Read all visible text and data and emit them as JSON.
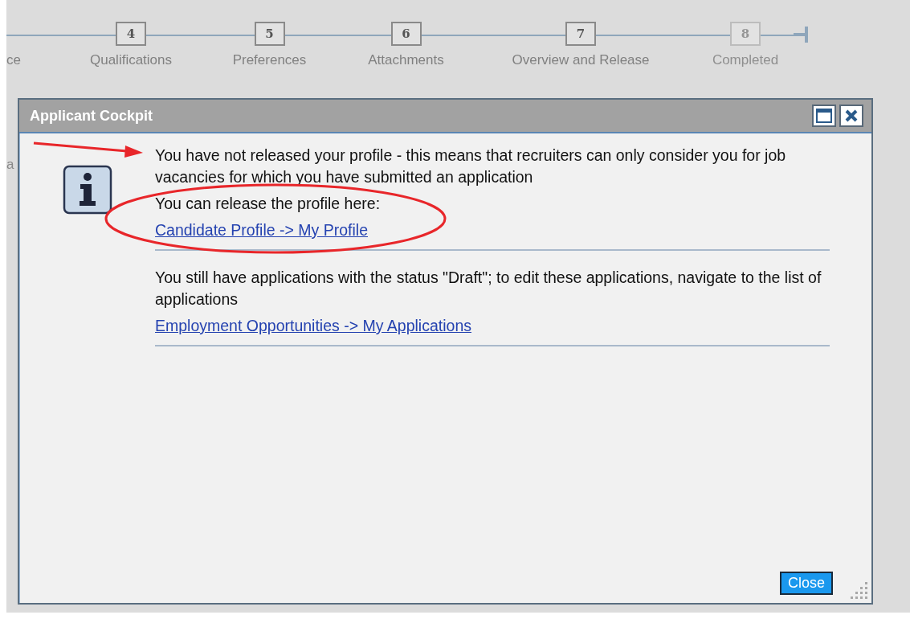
{
  "steps": [
    {
      "label": "ce",
      "disabled": false
    },
    {
      "number": "4",
      "label": "Qualifications",
      "disabled": false
    },
    {
      "number": "5",
      "label": "Preferences",
      "disabled": false
    },
    {
      "number": "6",
      "label": "Attachments",
      "disabled": false
    },
    {
      "number": "7",
      "label": "Overview and Release",
      "disabled": false
    },
    {
      "number": "8",
      "label": "Completed",
      "disabled": true
    }
  ],
  "page_fragment": "a",
  "dialog": {
    "title": "Applicant Cockpit",
    "sections": [
      {
        "lines": [
          "You have not released your profile - this means that recruiters can only consider you for job vacancies for which you have submitted an application",
          "You can release the profile here:"
        ],
        "link": "Candidate Profile -> My Profile"
      },
      {
        "lines": [
          "You still have applications with the status \"Draft\"; to edit these applications, navigate to the list of applications"
        ],
        "link": "Employment Opportunities -> My Applications"
      }
    ],
    "close_button": "Close"
  }
}
